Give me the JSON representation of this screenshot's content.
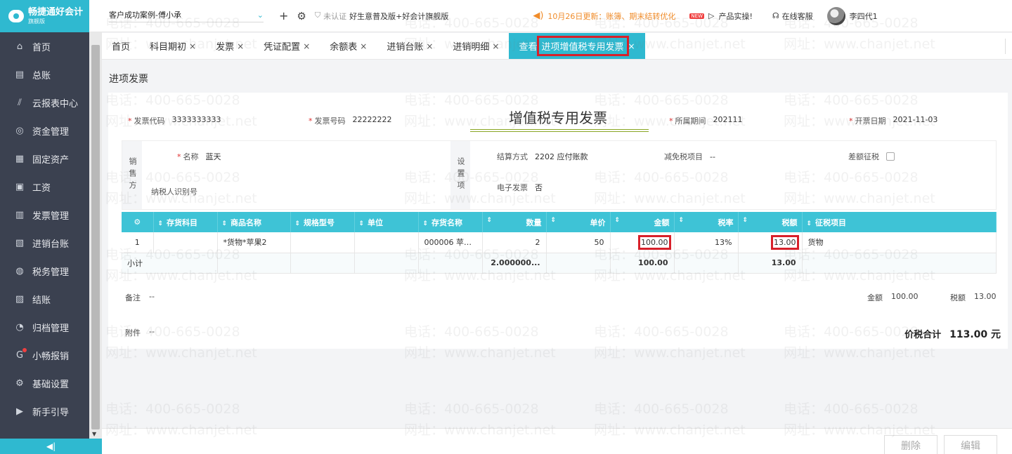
{
  "app": {
    "logo_name": "畅捷通好会计",
    "logo_sub": "旗舰版"
  },
  "sidebar": {
    "items": [
      {
        "label": "首页",
        "icon": "home-icon",
        "glyph": "⌂"
      },
      {
        "label": "总账",
        "icon": "ledger-icon",
        "glyph": "▤"
      },
      {
        "label": "云报表中心",
        "icon": "chart-icon",
        "glyph": "⫽"
      },
      {
        "label": "资金管理",
        "icon": "money-icon",
        "glyph": "◎"
      },
      {
        "label": "固定资产",
        "icon": "asset-icon",
        "glyph": "▦"
      },
      {
        "label": "工资",
        "icon": "salary-icon",
        "glyph": "▣"
      },
      {
        "label": "发票管理",
        "icon": "invoice-icon",
        "glyph": "▥"
      },
      {
        "label": "进销台账",
        "icon": "stock-icon",
        "glyph": "▧"
      },
      {
        "label": "税务管理",
        "icon": "tax-icon",
        "glyph": "◍"
      },
      {
        "label": "结账",
        "icon": "close-book-icon",
        "glyph": "▨"
      },
      {
        "label": "归档管理",
        "icon": "archive-icon",
        "glyph": "◔"
      },
      {
        "label": "小畅报销",
        "icon": "reimburse-icon",
        "glyph": "G"
      },
      {
        "label": "基础设置",
        "icon": "settings-icon",
        "glyph": "⚙"
      },
      {
        "label": "新手引导",
        "icon": "guide-icon",
        "glyph": "▶"
      }
    ],
    "collapse_glyph": "◀|"
  },
  "header": {
    "company": "客户成功案例-傅小承",
    "cert_status": "未认证",
    "version": "好生意普及版+好会计旗舰版",
    "notice": "10月26日更新：账簿、期末结转优化",
    "new_badge": "NEW",
    "product_link": "产品实操!",
    "service": "在线客服",
    "user": "李四代1"
  },
  "tabs": [
    {
      "label": "首页",
      "closable": false
    },
    {
      "label": "科目期初",
      "closable": true
    },
    {
      "label": "发票",
      "closable": true
    },
    {
      "label": "凭证配置",
      "closable": true
    },
    {
      "label": "余额表",
      "closable": true
    },
    {
      "label": "进销台账",
      "closable": true
    },
    {
      "label": "进销明细",
      "closable": true
    }
  ],
  "active_tab": {
    "prefix": "查看",
    "label": "进项增值税专用发票"
  },
  "page": {
    "title": "进项发票"
  },
  "invoice": {
    "title": "增值税专用发票",
    "code_label": "发票代码",
    "code": "3333333333",
    "number_label": "发票号码",
    "number": "22222222",
    "period_label": "所属期间",
    "period": "202111",
    "date_label": "开票日期",
    "date": "2021-11-03",
    "seller_side": "销售方",
    "name_label": "名称",
    "name": "蓝天",
    "taxid_label": "纳税人识别号",
    "settings_side": "设置项",
    "settle_label": "结算方式",
    "settle": "2202 应付账款",
    "exempt_label": "减免税项目",
    "exempt": "--",
    "diff_label": "差额征税",
    "einv_label": "电子发票",
    "einv": "否"
  },
  "grid": {
    "headers": [
      "存货科目",
      "商品名称",
      "规格型号",
      "单位",
      "存货名称",
      "数量",
      "单价",
      "金额",
      "税率",
      "税额",
      "征税项目"
    ],
    "rows": [
      {
        "idx": "1",
        "account": "",
        "goods": "*货物*苹果2",
        "spec": "",
        "unit": "",
        "stock": "000006 苹果...",
        "qty": "2",
        "price": "50",
        "amount": "100.00",
        "rate": "13%",
        "tax": "13.00",
        "item": "货物"
      }
    ],
    "subtotal": {
      "label": "小计",
      "qty": "2.000000...",
      "amount": "100.00",
      "tax": "13.00"
    }
  },
  "footer_info": {
    "remark_label": "备注",
    "remark": "--",
    "attach_label": "附件",
    "attach": "--",
    "amount_label": "金额",
    "amount": "100.00",
    "tax_label": "税额",
    "tax": "13.00",
    "total_label": "价税合计",
    "total": "113.00 元"
  },
  "actions": {
    "delete": "删除",
    "edit": "编辑"
  },
  "watermark": {
    "phone": "电话：400-665-0028",
    "site": "网址：www.chanjet.net"
  },
  "colors": {
    "accent": "#2fb9d0",
    "sidebar": "#3b4150",
    "highlight": "#d8202a",
    "notice": "#f08c2a"
  }
}
